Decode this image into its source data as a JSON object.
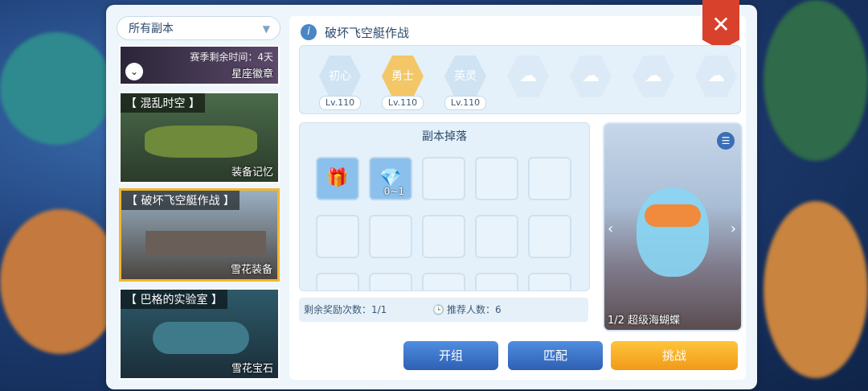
{
  "sidebar": {
    "filter_label": "所有副本",
    "cards": [
      {
        "timer": "赛季剩余时间：4天",
        "sub": "星座徽章"
      },
      {
        "title": "【 混乱时空 】",
        "sub": "装备记忆"
      },
      {
        "title": "【 破坏飞空艇作战 】",
        "sub": "雪花装备"
      },
      {
        "title": "【 巴格的实验室 】",
        "sub": "雪花宝石"
      }
    ]
  },
  "main": {
    "title": "破坏飞空艇作战",
    "difficulties": [
      {
        "label": "初心",
        "level": "Lv.110"
      },
      {
        "label": "勇士",
        "level": "Lv.110"
      },
      {
        "label": "英灵",
        "level": "Lv.110"
      }
    ],
    "drops_title": "副本掉落",
    "drop_items": [
      {
        "qty": ""
      },
      {
        "qty": "0~1"
      }
    ],
    "stats": {
      "reward_left": "剩余奖励次数：1/1",
      "recommended": "推荐人数：6"
    },
    "preview": {
      "name": "1/2 超级海蝴蝶"
    },
    "buttons": {
      "team": "开组",
      "match": "匹配",
      "challenge": "挑战"
    }
  },
  "colors": {
    "accent": "#f4b62c",
    "close": "#d8412b",
    "primary": "#2e60b3"
  }
}
